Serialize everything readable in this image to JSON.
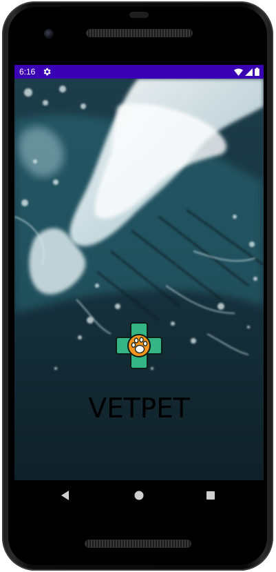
{
  "status_bar": {
    "time": "6:16",
    "background_color": "#3a00b3",
    "icons": [
      "settings-gear-icon",
      "wifi-icon",
      "cellular-signal-icon",
      "battery-icon"
    ]
  },
  "app": {
    "title": "VETPET",
    "logo": "vet-cross-paw-logo",
    "logo_colors": {
      "cross": "#35b486",
      "circle": "#f7941d",
      "paw": "#ffffff"
    },
    "background": "ocean-waves-aerial-photo"
  },
  "nav_bar": {
    "buttons": [
      "back-triangle-icon",
      "home-circle-icon",
      "recents-square-icon"
    ]
  }
}
